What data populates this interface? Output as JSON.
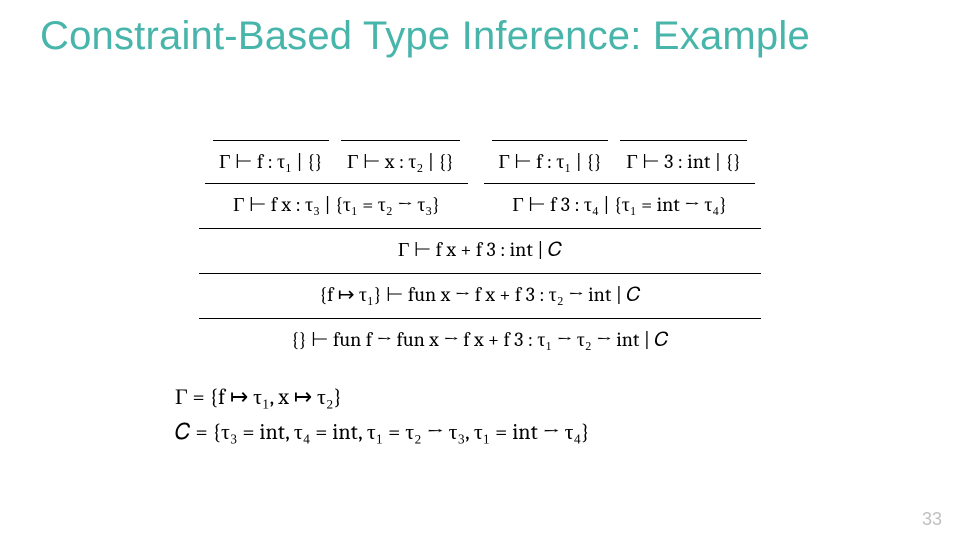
{
  "colors": {
    "title": "#48b5ab"
  },
  "title": "Constraint-Based Type Inference: Example",
  "pagenum": "33",
  "axioms": {
    "a1": "Γ ⊢ f : τ₁ | {}",
    "a2": "Γ ⊢ x : τ₂ | {}",
    "a3": "Γ ⊢ f : τ₁ | {}",
    "a4": "Γ ⊢ 3 : int | {}"
  },
  "mid": {
    "m1": "Γ  ⊢  f x : τ₃ | {τ₁ = τ₂ → τ₃}",
    "m2": "Γ ⊢ f 3 : τ₄ | {τ₁ = int → τ₄}"
  },
  "lines": {
    "l3": "Γ ⊢ f x + f 3 : int | 𝐶",
    "l4": "{f ↦ τ₁} ⊢ fun x → f x + f 3 : τ₂ → int | 𝐶",
    "l5": "{} ⊢ fun f → fun x → f x + f 3 : τ₁ → τ₂ → int | 𝐶"
  },
  "defs": {
    "gamma": "Γ = {f ↦ τ₁, x ↦ τ₂}",
    "C": "𝐶 = {τ₃ = int, τ₄ = int, τ₁ = τ₂ → τ₃, τ₁ = int → τ₄}"
  }
}
